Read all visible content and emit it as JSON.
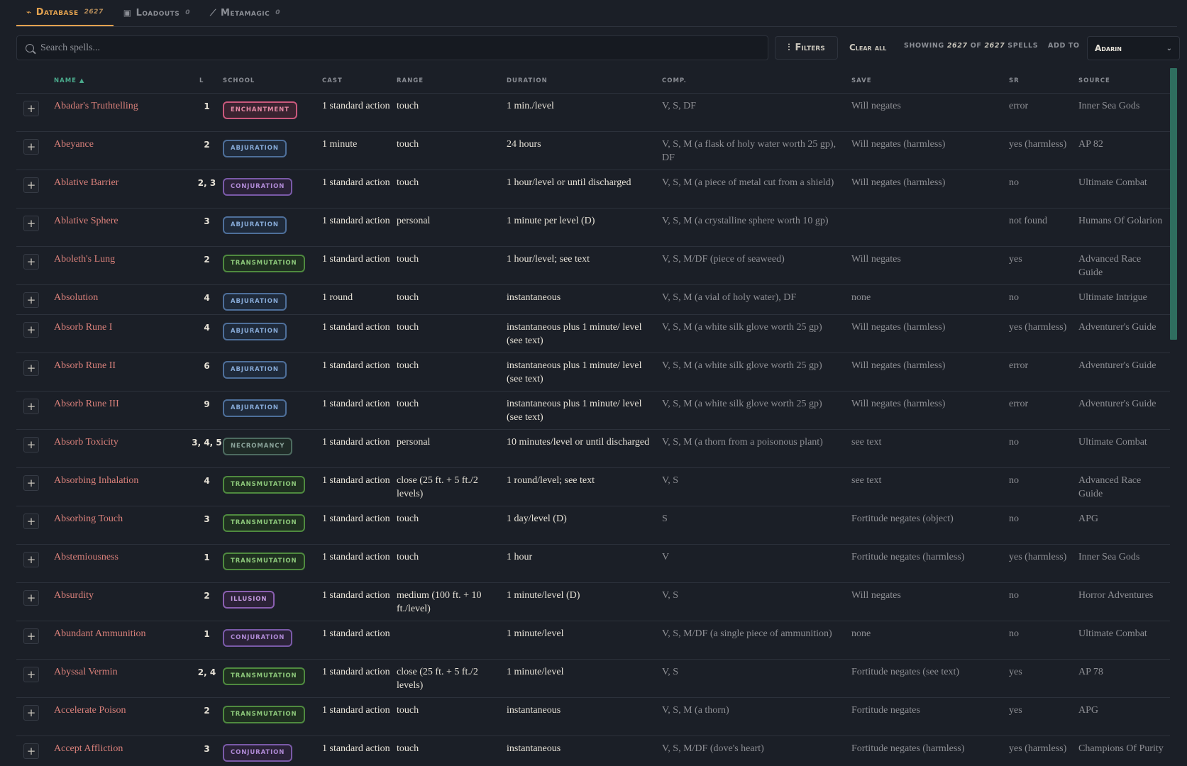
{
  "tabs": [
    {
      "icon": "scroll-icon",
      "glyph": "⌁",
      "label": "Database",
      "count": "2627",
      "active": true
    },
    {
      "icon": "book-icon",
      "glyph": "▣",
      "label": "Loadouts",
      "count": "0",
      "active": false
    },
    {
      "icon": "wand-icon",
      "glyph": "⟋",
      "label": "Metamagic",
      "count": "0",
      "active": false
    }
  ],
  "toolbar": {
    "search_placeholder": "Search spells...",
    "search_value": "",
    "filters_label": "Filters",
    "clear_label": "Clear all",
    "showing_prefix": "Showing",
    "showing_count": "2627",
    "showing_of": "of",
    "showing_total": "2627",
    "showing_suffix": "spells",
    "add_to_label": "Add to",
    "character": "Adarin"
  },
  "columns": {
    "name": "Name ▲",
    "level": "L",
    "school": "School",
    "cast": "Cast",
    "range": "Range",
    "duration": "Duration",
    "comp": "Comp.",
    "save": "Save",
    "sr": "SR",
    "source": "Source"
  },
  "school_colors": {
    "enchantment": {
      "text": "#e68aa6",
      "border": "#c9587c",
      "bg": "#3a2330"
    },
    "abjuration": {
      "text": "#86a9d6",
      "border": "#4e6f9a",
      "bg": "#1f2a3a"
    },
    "conjuration": {
      "text": "#b08ad6",
      "border": "#7a5aa8",
      "bg": "#2a2238"
    },
    "transmutation": {
      "text": "#8cc77a",
      "border": "#4f8a3f",
      "bg": "#1f3020"
    },
    "necromancy": {
      "text": "#8aa39a",
      "border": "#4d6b60",
      "bg": "#1f2b27"
    },
    "illusion": {
      "text": "#c49ae0",
      "border": "#8a5fb0",
      "bg": "#2c2238"
    }
  },
  "spells": [
    {
      "name": "Abadar's Truthtelling",
      "level": "1",
      "school": "enchantment",
      "cast": "1 standard action",
      "range": "touch",
      "duration": "1 min./level",
      "comp": "V, S, DF",
      "save": "Will negates",
      "sr": "error",
      "source": "Inner Sea Gods"
    },
    {
      "name": "Abeyance",
      "level": "2",
      "school": "abjuration",
      "cast": "1 minute",
      "range": "touch",
      "duration": "24 hours",
      "comp": "V, S, M (a flask of holy water worth 25 gp), DF",
      "save": "Will negates (harmless)",
      "sr": "yes (harmless)",
      "source": "AP 82"
    },
    {
      "name": "Ablative Barrier",
      "level": "2, 3",
      "school": "conjuration",
      "cast": "1 standard action",
      "range": "touch",
      "duration": "1 hour/level or until discharged",
      "comp": "V, S, M (a piece of metal cut from a shield)",
      "save": "Will negates (harmless)",
      "sr": "no",
      "source": "Ultimate Combat"
    },
    {
      "name": "Ablative Sphere",
      "level": "3",
      "school": "abjuration",
      "cast": "1 standard action",
      "range": "personal",
      "duration": "1 minute per level (D)",
      "comp": "V, S, M (a crystalline sphere worth 10 gp)",
      "save": "",
      "sr": "not found",
      "source": "Humans Of Golarion"
    },
    {
      "name": "Aboleth's Lung",
      "level": "2",
      "school": "transmutation",
      "cast": "1 standard action",
      "range": "touch",
      "duration": "1 hour/level; see text",
      "comp": "V, S, M/DF (piece of seaweed)",
      "save": "Will negates",
      "sr": "yes",
      "source": "Advanced Race Guide"
    },
    {
      "name": "Absolution",
      "level": "4",
      "school": "abjuration",
      "cast": "1 round",
      "range": "touch",
      "duration": "instantaneous",
      "comp": "V, S, M (a vial of holy water), DF",
      "save": "none",
      "sr": "no",
      "source": "Ultimate Intrigue"
    },
    {
      "name": "Absorb Rune I",
      "level": "4",
      "school": "abjuration",
      "cast": "1 standard action",
      "range": "touch",
      "duration": "instantaneous plus 1 minute/ level (see text)",
      "comp": "V, S, M (a white silk glove worth 25 gp)",
      "save": "Will negates (harmless)",
      "sr": "yes (harmless)",
      "source": "Adventurer's Guide"
    },
    {
      "name": "Absorb Rune II",
      "level": "6",
      "school": "abjuration",
      "cast": "1 standard action",
      "range": "touch",
      "duration": "instantaneous plus 1 minute/ level (see text)",
      "comp": "V, S, M (a white silk glove worth 25 gp)",
      "save": "Will negates (harmless)",
      "sr": "error",
      "source": "Adventurer's Guide"
    },
    {
      "name": "Absorb Rune III",
      "level": "9",
      "school": "abjuration",
      "cast": "1 standard action",
      "range": "touch",
      "duration": "instantaneous plus 1 minute/ level (see text)",
      "comp": "V, S, M (a white silk glove worth 25 gp)",
      "save": "Will negates (harmless)",
      "sr": "error",
      "source": "Adventurer's Guide"
    },
    {
      "name": "Absorb Toxicity",
      "level": "3, 4, 5",
      "school": "necromancy",
      "cast": "1 standard action",
      "range": "personal",
      "duration": "10 minutes/level or until discharged",
      "comp": "V, S, M (a thorn from a poisonous plant)",
      "save": "see text",
      "sr": "no",
      "source": "Ultimate Combat"
    },
    {
      "name": "Absorbing Inhalation",
      "level": "4",
      "school": "transmutation",
      "cast": "1 standard action",
      "range": "close (25 ft. + 5 ft./2 levels)",
      "duration": "1 round/level; see text",
      "comp": "V, S",
      "save": "see text",
      "sr": "no",
      "source": "Advanced Race Guide"
    },
    {
      "name": "Absorbing Touch",
      "level": "3",
      "school": "transmutation",
      "cast": "1 standard action",
      "range": "touch",
      "duration": "1 day/level (D)",
      "comp": "S",
      "save": "Fortitude negates (object)",
      "sr": "no",
      "source": "APG"
    },
    {
      "name": "Abstemiousness",
      "level": "1",
      "school": "transmutation",
      "cast": "1 standard action",
      "range": "touch",
      "duration": "1 hour",
      "comp": "V",
      "save": "Fortitude negates (harmless)",
      "sr": "yes (harmless)",
      "source": "Inner Sea Gods"
    },
    {
      "name": "Absurdity",
      "level": "2",
      "school": "illusion",
      "cast": "1 standard action",
      "range": "medium (100 ft. + 10 ft./level)",
      "duration": "1 minute/level (D)",
      "comp": "V, S",
      "save": "Will negates",
      "sr": "no",
      "source": "Horror Adventures"
    },
    {
      "name": "Abundant Ammunition",
      "level": "1",
      "school": "conjuration",
      "cast": "1 standard action",
      "range": "",
      "duration": "1 minute/level",
      "comp": "V, S, M/DF (a single piece of ammunition)",
      "save": "none",
      "sr": "no",
      "source": "Ultimate Combat"
    },
    {
      "name": "Abyssal Vermin",
      "level": "2, 4",
      "school": "transmutation",
      "cast": "1 standard action",
      "range": "close (25 ft. + 5 ft./2 levels)",
      "duration": "1 minute/level",
      "comp": "V, S",
      "save": "Fortitude negates (see text)",
      "sr": "yes",
      "source": "AP 78"
    },
    {
      "name": "Accelerate Poison",
      "level": "2",
      "school": "transmutation",
      "cast": "1 standard action",
      "range": "touch",
      "duration": "instantaneous",
      "comp": "V, S, M (a thorn)",
      "save": "Fortitude negates",
      "sr": "yes",
      "source": "APG"
    },
    {
      "name": "Accept Affliction",
      "level": "3",
      "school": "conjuration",
      "cast": "1 standard action",
      "range": "touch",
      "duration": "instantaneous",
      "comp": "V, S, M/DF (dove's heart)",
      "save": "Fortitude negates (harmless)",
      "sr": "yes (harmless)",
      "source": "Champions Of Purity"
    }
  ]
}
